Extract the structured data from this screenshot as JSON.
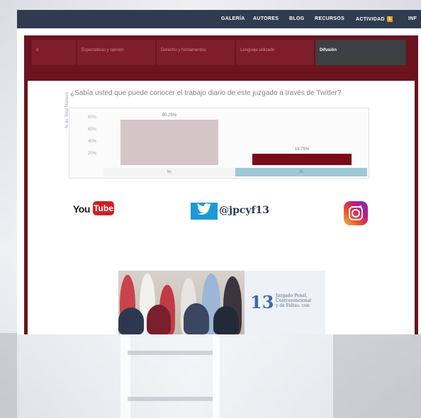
{
  "nav": {
    "items": [
      "GALERÍA",
      "AUTORES",
      "BLOG",
      "RECURSOS",
      "ACTIVIDAD",
      "INF"
    ],
    "activity_badge": "1"
  },
  "tabs": [
    {
      "label": "d",
      "active": false
    },
    {
      "label": "Expectativas y opinión",
      "active": false
    },
    {
      "label": "Derecho y fundamentos",
      "active": false
    },
    {
      "label": "Lenguaje utilizado",
      "active": false
    },
    {
      "label": "Difusión",
      "active": true
    }
  ],
  "question": "¿Sabía usted que puede conocer el trabajo diario de este juzgado a través de Twitter?",
  "chart_data": {
    "type": "bar",
    "ylabel": "% de Total Número",
    "yticks": [
      "80%",
      "60%",
      "40%",
      "20%"
    ],
    "ylim": [
      0,
      100
    ],
    "categories": [
      "No",
      "Sí"
    ],
    "values": [
      80.25,
      19.75
    ],
    "data_labels": [
      "80.25%",
      "19.75%"
    ],
    "colors": [
      "#d6c5c7",
      "#7a0c18"
    ],
    "grid": false
  },
  "social": {
    "youtube_word": "You",
    "youtube_box": "Tube",
    "twitter_handle": "@jpcyf13"
  },
  "team": {
    "logo_number": "13",
    "logo_lines": [
      "Juzgado Penal,",
      "Contravencional",
      "y de Faltas. con"
    ]
  },
  "colors": {
    "brand": "#6b1420",
    "nav": "#2f3c4f",
    "twitter": "#1c9ad8",
    "youtube": "#d01f26"
  }
}
